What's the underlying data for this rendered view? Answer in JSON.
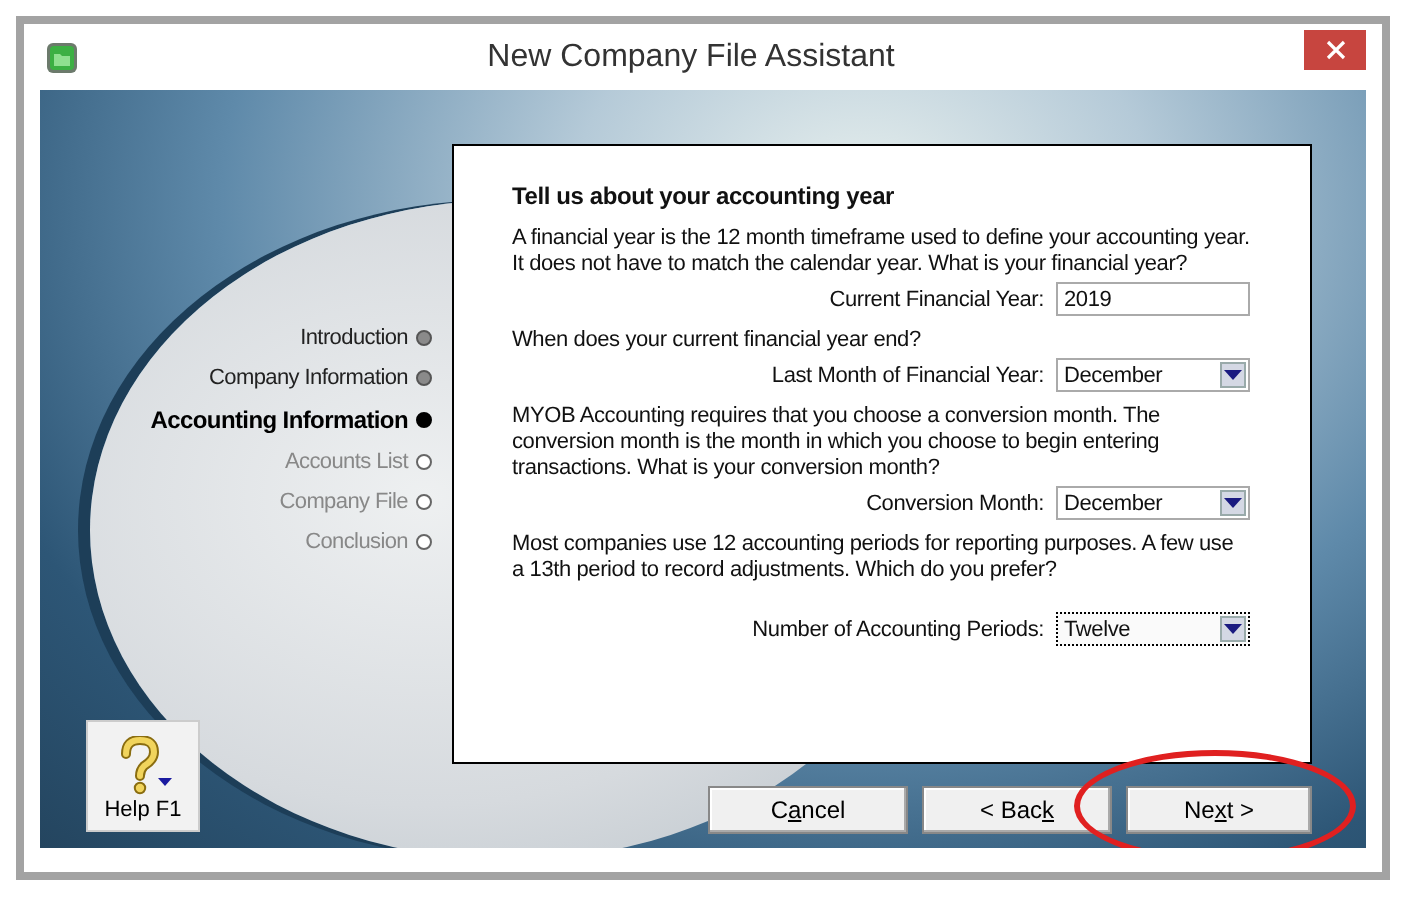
{
  "window": {
    "title": "New Company File Assistant"
  },
  "steps": [
    {
      "label": "Introduction",
      "completed": true,
      "current": false
    },
    {
      "label": "Company Information",
      "completed": true,
      "current": false
    },
    {
      "label": "Accounting Information",
      "completed": false,
      "current": true
    },
    {
      "label": "Accounts List",
      "completed": false,
      "current": false
    },
    {
      "label": "Company File",
      "completed": false,
      "current": false
    },
    {
      "label": "Conclusion",
      "completed": false,
      "current": false
    }
  ],
  "page": {
    "heading": "Tell us about your accounting year",
    "sections": [
      {
        "text": "A financial year is the 12 month timeframe used to define your accounting year.  It does not have to match the calendar year.  What is your financial year?",
        "field": {
          "label": "Current Financial Year:",
          "kind": "text",
          "value": "2019",
          "focused": false
        }
      },
      {
        "text": "When does your current financial year end?",
        "field": {
          "label": "Last Month of Financial Year:",
          "kind": "dropdown",
          "value": "December",
          "focused": false
        }
      },
      {
        "text": "MYOB Accounting requires that you choose a conversion month.  The conversion month is the month in which you choose to begin entering transactions.  What is your conversion month?",
        "field": {
          "label": "Conversion Month:",
          "kind": "dropdown",
          "value": "December",
          "focused": false
        }
      },
      {
        "text": "Most companies use 12 accounting periods for reporting purposes.  A few use a 13th period to record adjustments.  Which do you prefer?",
        "field": {
          "label": "Number of Accounting Periods:",
          "kind": "dropdown",
          "value": "Twelve",
          "focused": true
        }
      }
    ]
  },
  "help_button": {
    "label": "Help F1"
  },
  "buttons": [
    {
      "label_parts": [
        "C",
        "a",
        "ncel"
      ],
      "highlighted": false
    },
    {
      "label_parts": [
        "< Bac",
        "k"
      ],
      "highlighted": false
    },
    {
      "label_parts": [
        "Ne",
        "x",
        "t >"
      ],
      "highlighted": true
    }
  ]
}
